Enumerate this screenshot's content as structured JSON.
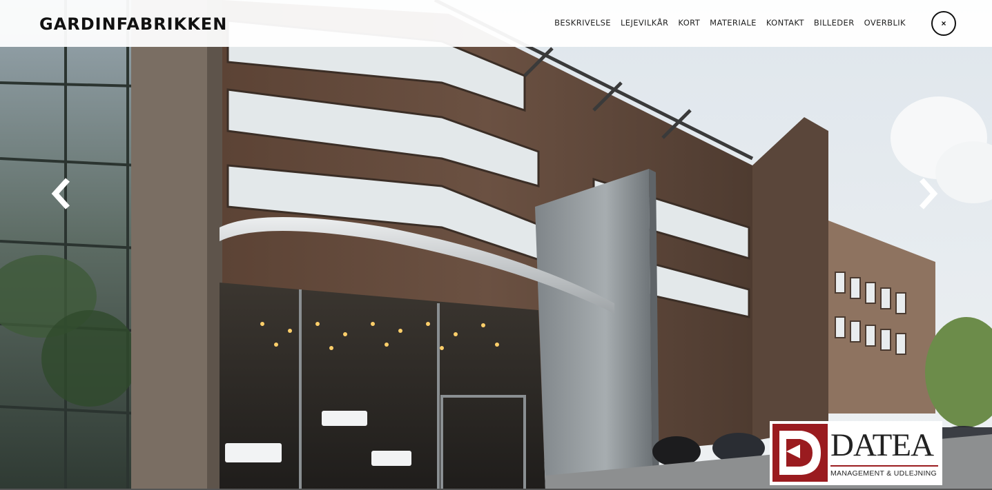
{
  "header": {
    "logo": "GARDINFABRIKKEN",
    "nav": [
      {
        "label": "BESKRIVELSE"
      },
      {
        "label": "LEJEVILKÅR"
      },
      {
        "label": "KORT"
      },
      {
        "label": "MATERIALE"
      },
      {
        "label": "KONTAKT"
      },
      {
        "label": "BILLEDER"
      },
      {
        "label": "OVERBLIK"
      }
    ],
    "close_icon": "close-icon",
    "close_symbol": "×"
  },
  "carousel": {
    "prev_icon": "chevron-left-icon",
    "next_icon": "chevron-right-icon",
    "image": "office-building-photo"
  },
  "badge": {
    "name": "DATEA",
    "subtitle": "MANAGEMENT & UDLEJNING",
    "brand_color": "#9a1b1f"
  },
  "colors": {
    "header_bg": "#ffffff",
    "text": "#111111",
    "facade": "#5a4a3e"
  }
}
